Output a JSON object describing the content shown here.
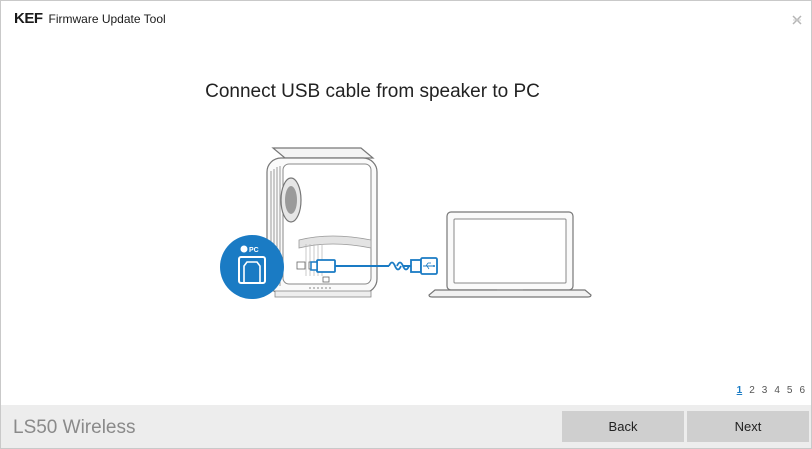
{
  "window": {
    "logo_text": "KEF",
    "title": "Firmware Update Tool"
  },
  "main": {
    "heading": "Connect USB cable from speaker to PC",
    "badge_label": "PC"
  },
  "pagination": {
    "steps": [
      "1",
      "2",
      "3",
      "4",
      "5",
      "6"
    ],
    "current": 1
  },
  "footer": {
    "product_name": "LS50 Wireless",
    "back_label": "Back",
    "next_label": "Next"
  },
  "colors": {
    "accent": "#1a7bc4",
    "button_bg": "#cfcfcf",
    "footer_bg": "#ededed",
    "product_text": "#8a8a8a"
  },
  "icons": {
    "close": "close-icon",
    "speaker": "speaker-illustration",
    "laptop": "laptop-illustration",
    "usb": "usb-icon"
  }
}
